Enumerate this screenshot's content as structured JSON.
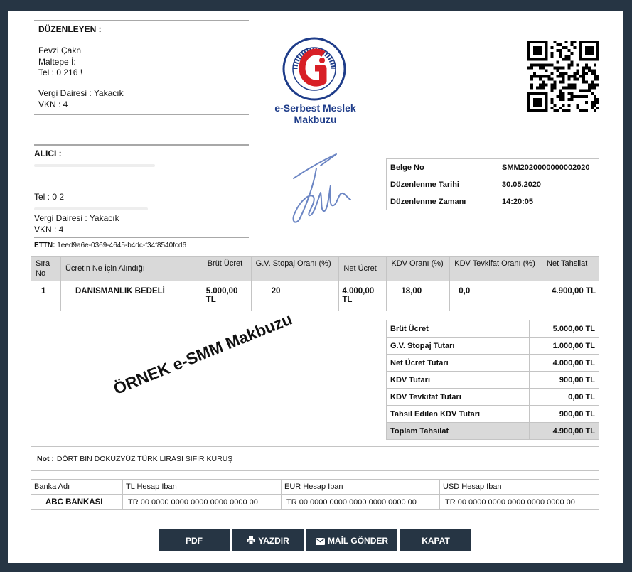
{
  "issuer": {
    "heading": "DÜZENLEYEN :",
    "name": "Fevzi Çakn",
    "address": "Maltepe  İ:",
    "phone": "Tel : 0 216 !",
    "tax_office": "Vergi Dairesi : Yakacık",
    "vkn": "VKN : 4"
  },
  "receiver": {
    "heading": "ALICI :",
    "phone": "Tel : 0 2",
    "tax_office": "Vergi Dairesi : Yakacık",
    "vkn": "VKN : 4"
  },
  "logo": {
    "ring_text": "T.C. MALİYE BAKANLIĞI · Gelir İdaresi Başkanlığı",
    "title_line1": "e-Serbest Meslek",
    "title_line2": "Makbuzu"
  },
  "doc_info": [
    {
      "label": "Belge No",
      "value": "SMM2020000000002020"
    },
    {
      "label": "Düzenlenme Tarihi",
      "value": "30.05.2020"
    },
    {
      "label": "Düzenlenme Zamanı",
      "value": "14:20:05"
    }
  ],
  "ettn": {
    "label": "ETTN:",
    "value": "1eed9a6e-0369-4645-b4dc-f34f8540fcd6"
  },
  "items_table": {
    "headers": {
      "sira": "Sıra No",
      "aciklama": "Ücretin Ne İçin Alındığı",
      "brut": "Brüt Ücret",
      "gv_oran": "G.V. Stopaj Oranı (%)",
      "net": "Net Ücret",
      "kdv_oran": "KDV Oranı (%)",
      "kdv_tevkifat": "KDV Tevkifat Oranı (%)",
      "net_tahsilat": "Net Tahsilat"
    },
    "row": {
      "sira": "1",
      "aciklama": "DANISMANLIK BEDELİ",
      "brut": "5.000,00 TL",
      "gv_oran": "20",
      "net": "4.000,00 TL",
      "kdv_oran": "18,00",
      "kdv_tevkifat": "0,0",
      "net_tahsilat": "4.900,00 TL"
    }
  },
  "watermark": "ÖRNEK e-SMM Makbuzu",
  "summary": [
    {
      "label": "Brüt Ücret",
      "value": "5.000,00 TL"
    },
    {
      "label": "G.V. Stopaj Tutarı",
      "value": "1.000,00 TL"
    },
    {
      "label": "Net Ücret Tutarı",
      "value": "4.000,00 TL"
    },
    {
      "label": "KDV Tutarı",
      "value": "900,00 TL"
    },
    {
      "label": "KDV Tevkifat Tutarı",
      "value": "0,00 TL"
    },
    {
      "label": "Tahsil Edilen KDV Tutarı",
      "value": "900,00 TL"
    },
    {
      "label": "Toplam Tahsilat",
      "value": "4.900,00 TL"
    }
  ],
  "note": {
    "label": "Not :",
    "text": "DÖRT BİN DOKUZYÜZ TÜRK LİRASI SIFIR KURUŞ"
  },
  "bank": {
    "headers": [
      "Banka Adı",
      "TL Hesap Iban",
      "EUR Hesap Iban",
      "USD Hesap Iban"
    ],
    "row": [
      "ABC BANKASI",
      "TR 00 0000 0000 0000 0000 0000 00",
      "TR 00 0000 0000 0000 0000 0000 00",
      "TR 00 0000 0000 0000 0000 0000 00"
    ]
  },
  "buttons": {
    "pdf": "PDF",
    "print": "YAZDIR",
    "mail": "MAİL GÖNDER",
    "close": "KAPAT"
  },
  "colors": {
    "frame": "#263544",
    "header_bg": "#d9d9d9",
    "logo_red": "#d81f26",
    "logo_blue": "#1f3d8a"
  }
}
